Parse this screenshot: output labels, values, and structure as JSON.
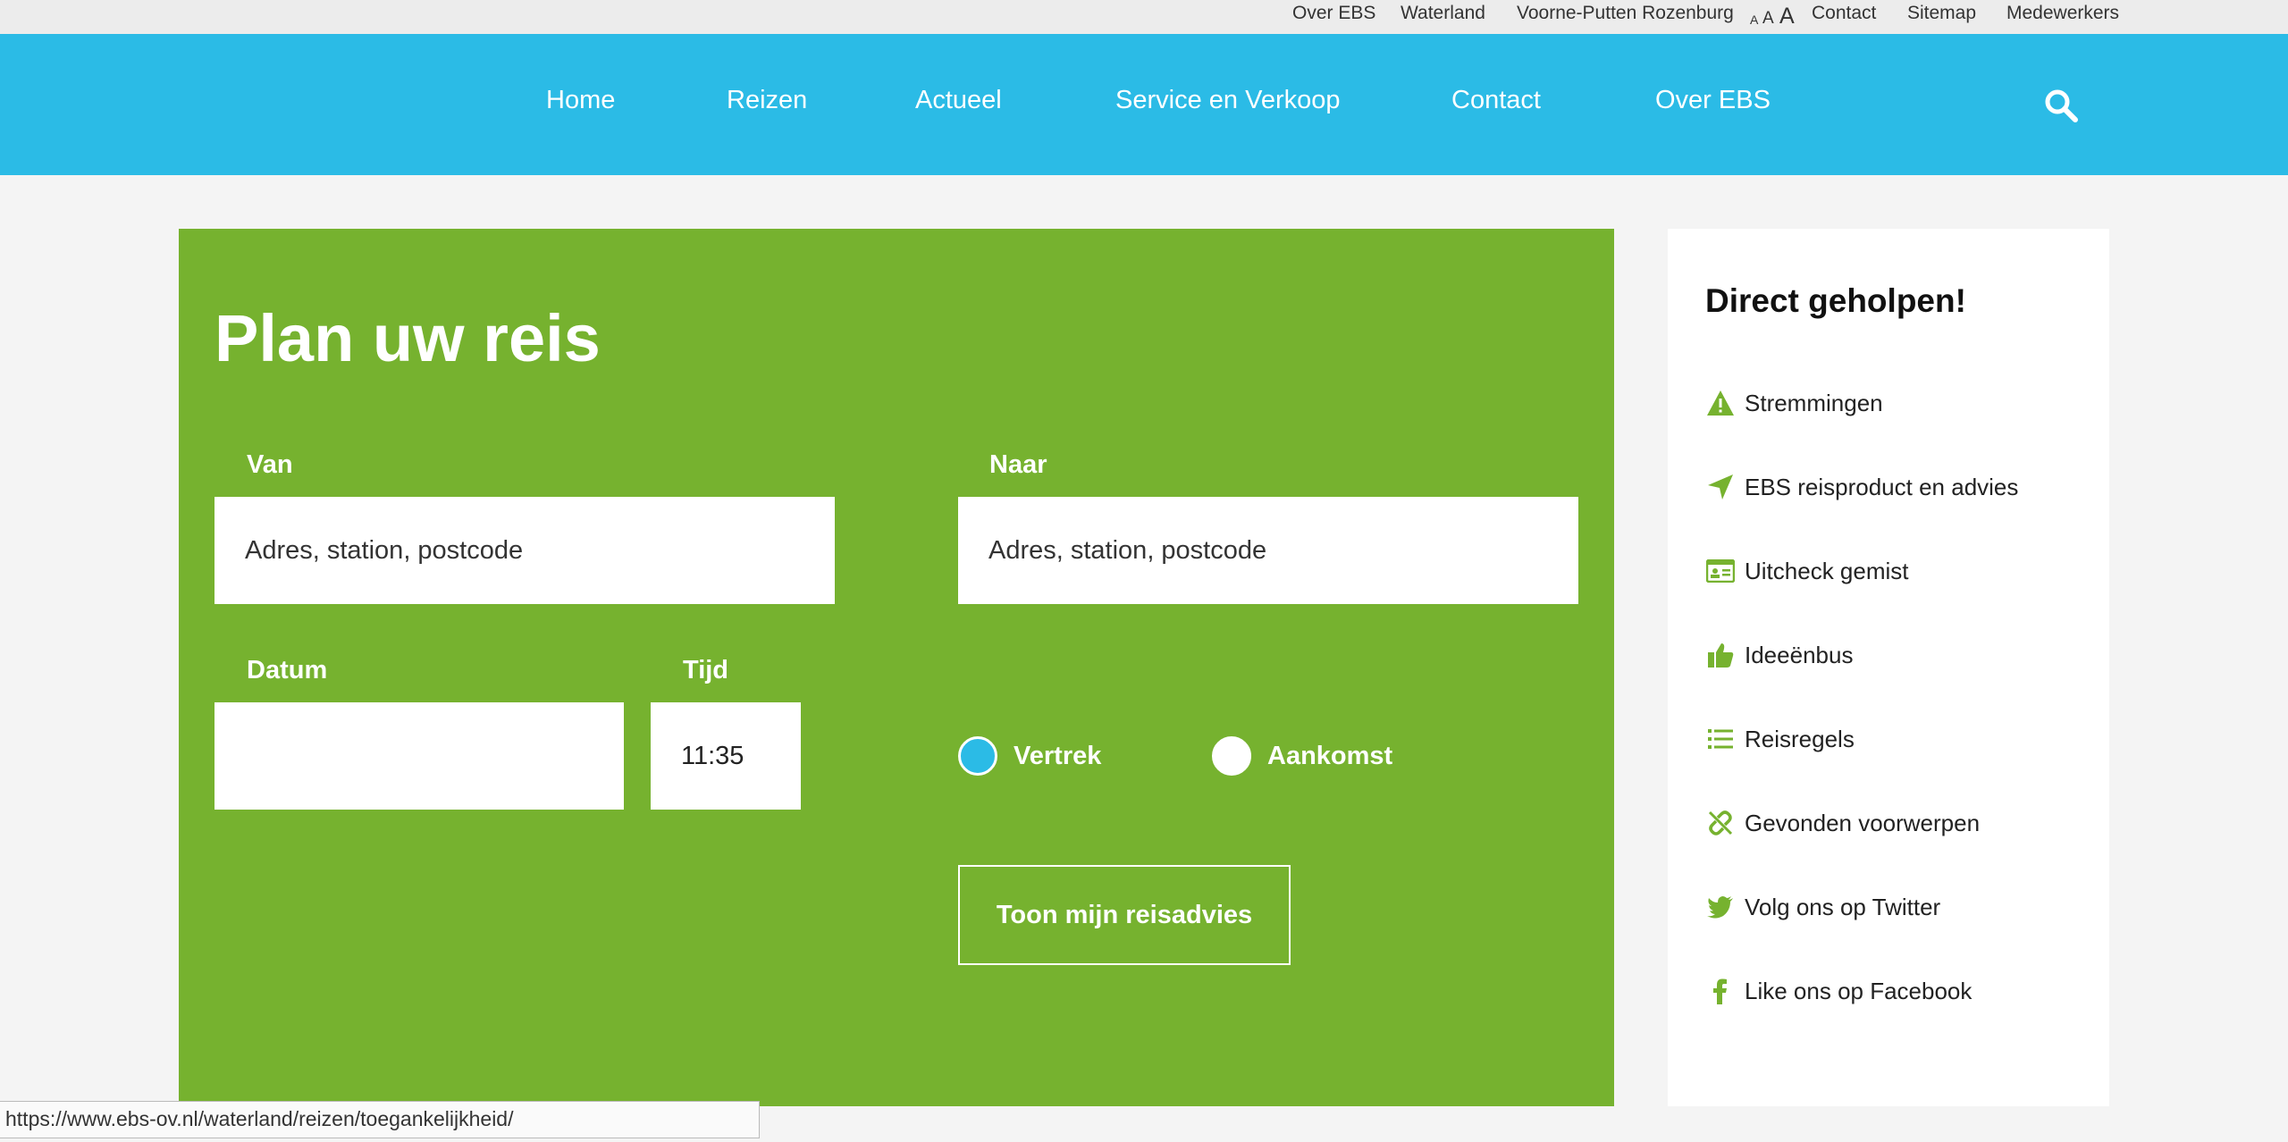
{
  "topbar": {
    "links": [
      "Over EBS",
      "Waterland",
      "Voorne-Putten Rozenburg"
    ],
    "font_sizes": [
      "A",
      "A",
      "A"
    ],
    "links_right": [
      "Contact",
      "Sitemap",
      "Medewerkers"
    ]
  },
  "nav": {
    "items": [
      "Home",
      "Reizen",
      "Actueel",
      "Service en Verkoop",
      "Contact",
      "Over EBS"
    ],
    "search_icon": "search-icon"
  },
  "planner": {
    "title": "Plan uw reis",
    "from": {
      "label": "Van",
      "placeholder": "Adres, station, postcode",
      "value": ""
    },
    "to": {
      "label": "Naar",
      "placeholder": "Adres, station, postcode",
      "value": ""
    },
    "date": {
      "label": "Datum",
      "value": ""
    },
    "time": {
      "label": "Tijd",
      "value": "11:35"
    },
    "mode": {
      "options": [
        "Vertrek",
        "Aankomst"
      ],
      "selected": "Vertrek"
    },
    "submit_label": "Toon mijn reisadvies"
  },
  "sidebar": {
    "title": "Direct geholpen!",
    "links": [
      {
        "label": "Stremmingen",
        "icon": "warning-icon"
      },
      {
        "label": "EBS reisproduct en advies",
        "icon": "navigation-arrow-icon"
      },
      {
        "label": "Uitcheck gemist",
        "icon": "id-card-icon"
      },
      {
        "label": "Ideeënbus",
        "icon": "thumbs-up-icon"
      },
      {
        "label": "Reisregels",
        "icon": "list-icon"
      },
      {
        "label": "Gevonden voorwerpen",
        "icon": "broken-link-icon"
      },
      {
        "label": "Volg ons op Twitter",
        "icon": "twitter-icon"
      },
      {
        "label": "Like ons op Facebook",
        "icon": "facebook-icon"
      }
    ]
  },
  "colors": {
    "nav_bg": "#2bbbe6",
    "planner_bg": "#76b22f",
    "accent_blue": "#2bbbe6"
  },
  "status_url": "https://www.ebs-ov.nl/waterland/reizen/toegankelijkheid/"
}
